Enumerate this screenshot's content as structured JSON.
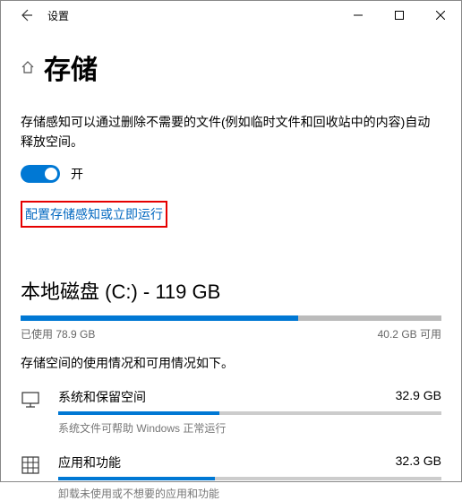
{
  "window": {
    "title": "设置"
  },
  "header": {
    "title": "存储"
  },
  "storage_sense": {
    "description": "存储感知可以通过删除不需要的文件(例如临时文件和回收站中的内容)自动释放空间。",
    "toggle_label": "开",
    "toggle_on": true,
    "link_text": "配置存储感知或立即运行"
  },
  "disk": {
    "title": "本地磁盘 (C:) - 119 GB",
    "used_label": "已使用 78.9 GB",
    "free_label": "40.2 GB 可用",
    "used_pct": 66,
    "subdesc": "存储空间的使用情况和可用情况如下。"
  },
  "categories": [
    {
      "name": "系统和保留空间",
      "size": "32.9 GB",
      "detail": "系统文件可帮助 Windows 正常运行",
      "pct": 42,
      "icon": "monitor-icon"
    },
    {
      "name": "应用和功能",
      "size": "32.3 GB",
      "detail": "卸载未使用或不想要的应用和功能",
      "pct": 41,
      "icon": "grid-icon"
    }
  ]
}
